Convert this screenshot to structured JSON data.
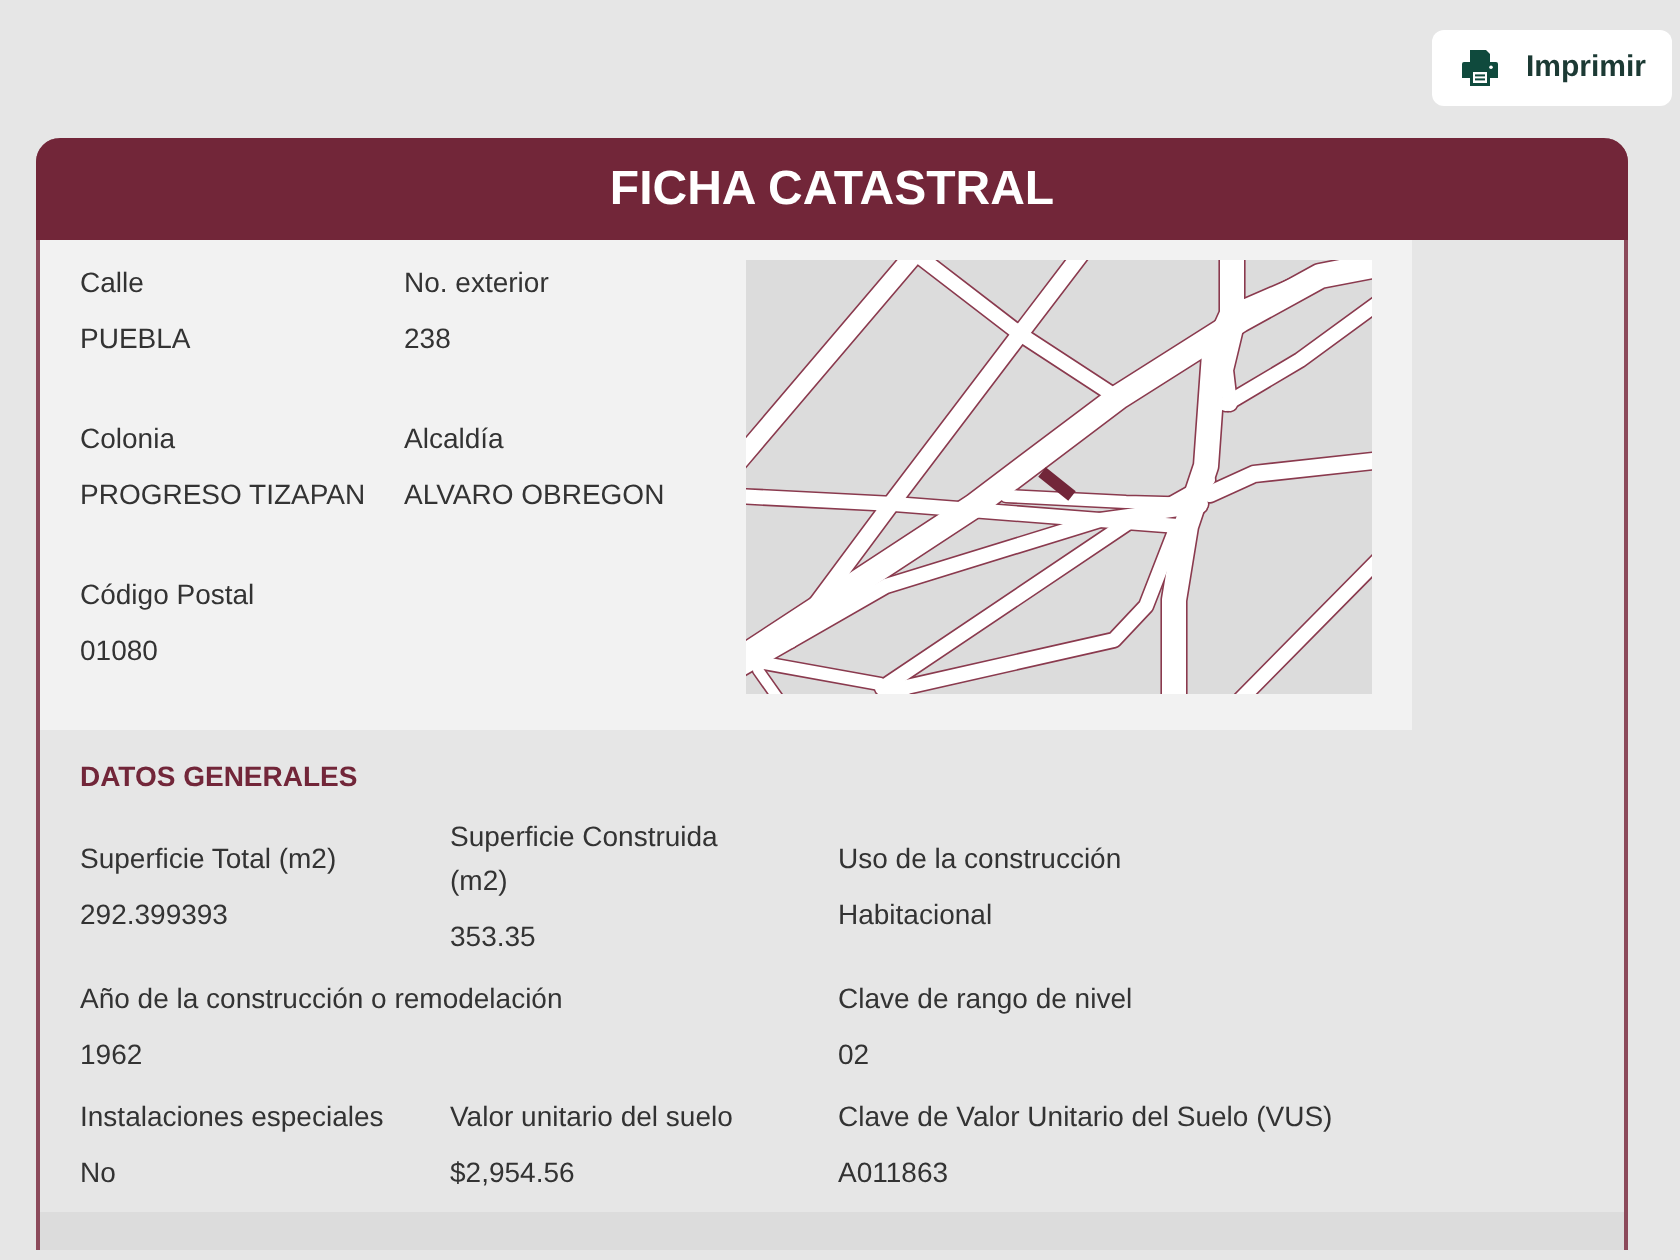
{
  "print_button": {
    "label": "Imprimir"
  },
  "card": {
    "title": "FICHA CATASTRAL",
    "location": {
      "rows": [
        {
          "fields": [
            {
              "label": "Calle",
              "value": "PUEBLA"
            },
            {
              "label": "No. exterior",
              "value": "238"
            }
          ]
        },
        {
          "fields": [
            {
              "label": "Colonia",
              "value": "PROGRESO TIZAPAN"
            },
            {
              "label": "Alcaldía",
              "value": "ALVARO OBREGON"
            }
          ]
        },
        {
          "fields": [
            {
              "label": "Código Postal",
              "value": "01080"
            }
          ]
        }
      ]
    },
    "general": {
      "heading": "DATOS GENERALES",
      "rows": [
        {
          "fields": [
            {
              "label": "Superficie Total (m2)",
              "value": "292.399393"
            },
            {
              "label": "Superficie Construida (m2)",
              "value": "353.35"
            },
            {
              "label": "Uso de la construcción",
              "value": "Habitacional"
            }
          ]
        },
        {
          "fields": [
            {
              "label": "Año de la construcción o remodelación",
              "value": "1962"
            },
            {
              "label": "Clave de rango de nivel",
              "value": "02"
            }
          ]
        },
        {
          "fields": [
            {
              "label": "Instalaciones especiales",
              "value": "No"
            },
            {
              "label": "Valor unitario del suelo",
              "value": "$2,954.56"
            },
            {
              "label": "Clave de Valor Unitario del Suelo (VUS)",
              "value": "A011863"
            }
          ]
        }
      ]
    }
  }
}
